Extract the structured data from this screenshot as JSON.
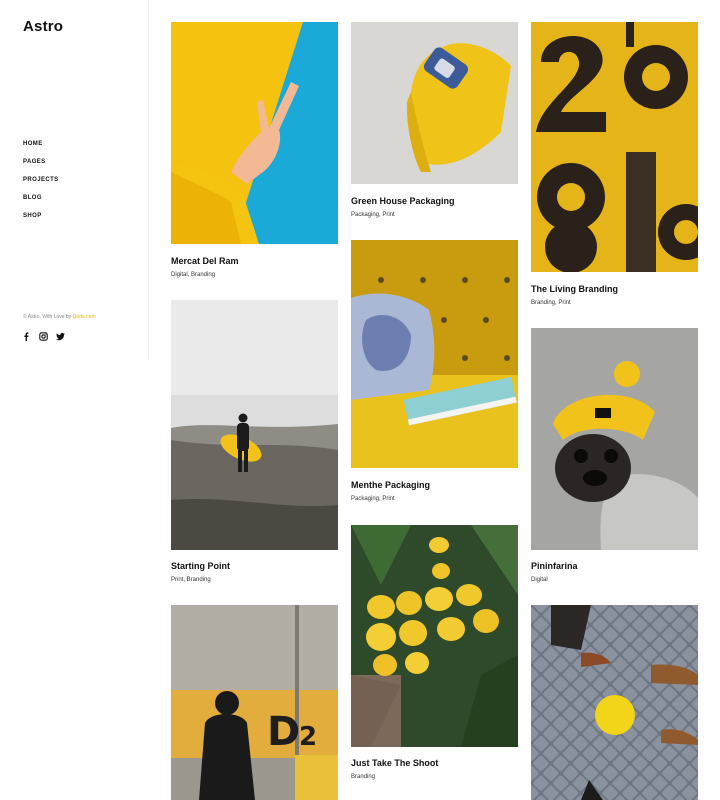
{
  "site": {
    "logo": "Astro"
  },
  "nav": {
    "items": [
      "HOME",
      "PAGES",
      "PROJECTS",
      "BLOG",
      "SHOP"
    ]
  },
  "footer": {
    "text": "© Astro. With Love by ",
    "link": "Qode.com"
  },
  "social": {
    "icons": [
      "facebook-icon",
      "instagram-icon",
      "twitter-icon"
    ]
  },
  "colors": {
    "accent": "#f2c21a",
    "text": "#111111"
  },
  "projects": [
    {
      "title": "Mercat Del Ram",
      "tags": "Digital, Branding"
    },
    {
      "title": "Starting Point",
      "tags": "Print, Branding"
    },
    {
      "title": "Green House Packaging",
      "tags": "Packaging, Print"
    },
    {
      "title": "Menthe Packaging",
      "tags": "Packaging, Print"
    },
    {
      "title": "Just Take The Shoot",
      "tags": "Branding"
    },
    {
      "title": "The Living Branding",
      "tags": "Branding, Print"
    },
    {
      "title": "Pininfarina",
      "tags": "Digital"
    }
  ]
}
